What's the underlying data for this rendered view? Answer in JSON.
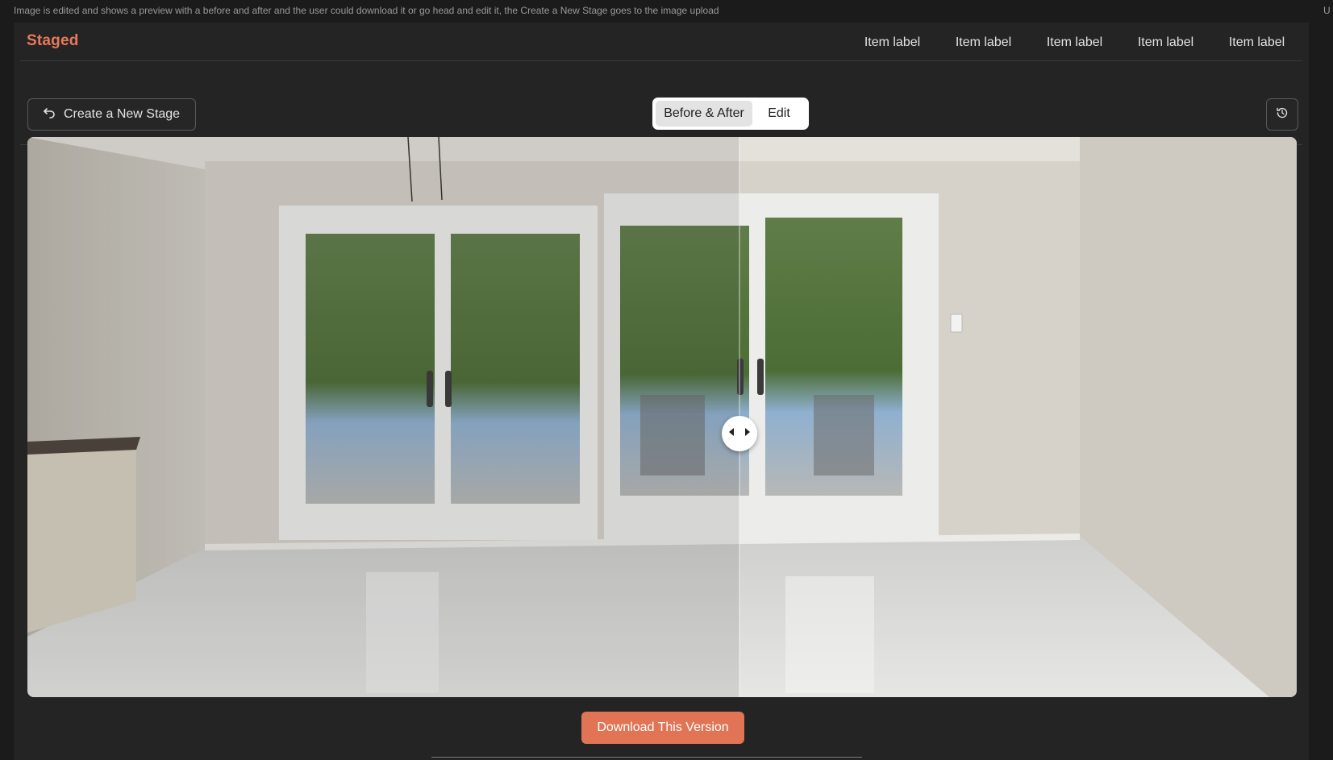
{
  "annotation": {
    "text": "Image is edited and shows a preview with a before and after and the user could download it or go head and edit it, the Create a New Stage goes to the image upload",
    "right_text": "U"
  },
  "header": {
    "brand": "Staged",
    "brand_color": "#e8795a",
    "nav": [
      "Item label",
      "Item label",
      "Item label",
      "Item label",
      "Item label"
    ]
  },
  "toolbar": {
    "create_label": "Create a New Stage",
    "create_icon": "undo-arrow-icon",
    "view_toggle": {
      "options": [
        "Before & After",
        "Edit"
      ],
      "selected": "Before & After"
    },
    "history_icon": "history-icon"
  },
  "compare": {
    "split_fraction": 0.561,
    "handle_icon": "arrows-horizontal-icon"
  },
  "actions": {
    "download_label": "Download This Version",
    "accent": "#e07455"
  }
}
